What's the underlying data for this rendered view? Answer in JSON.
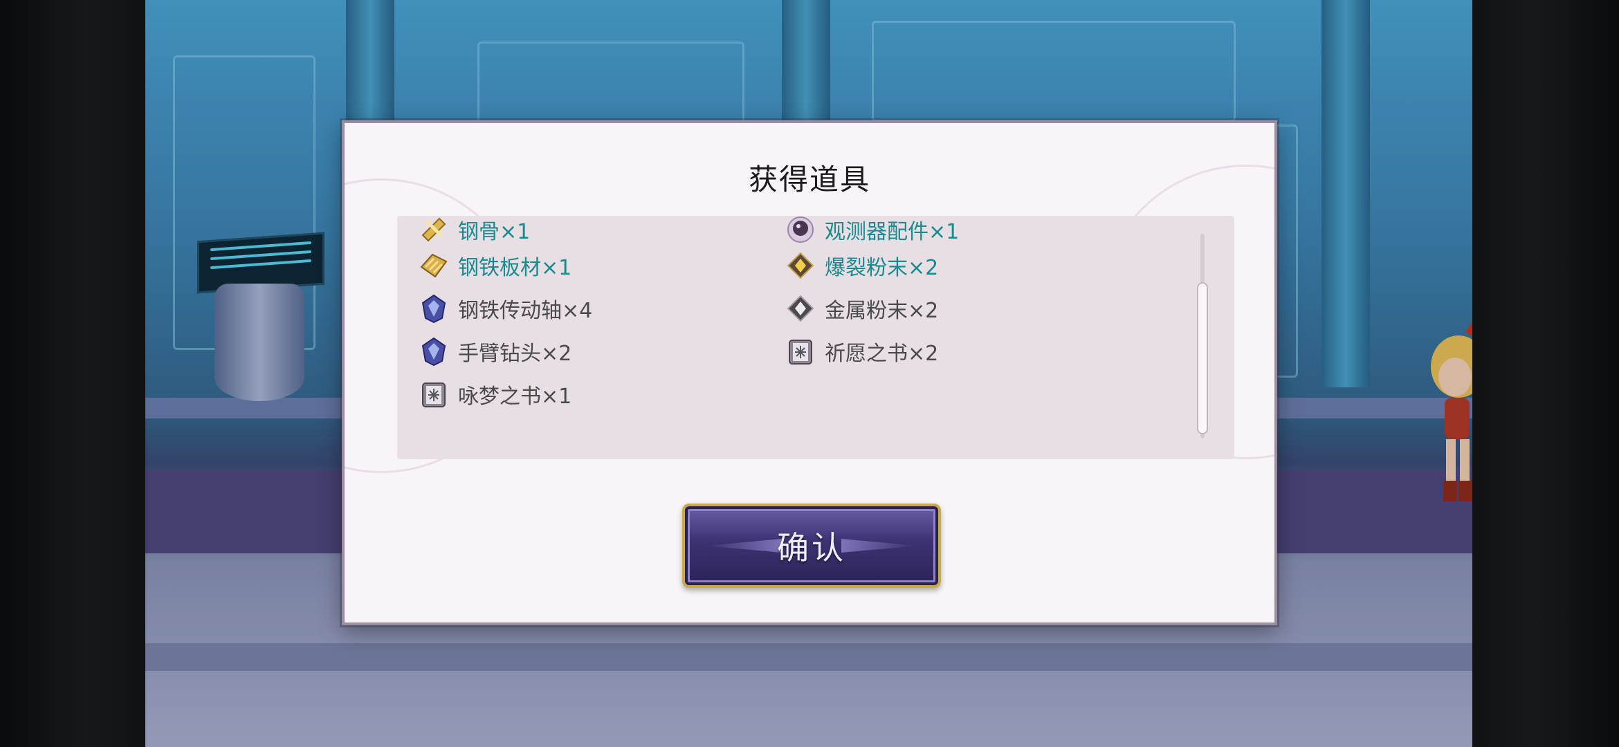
{
  "dialog": {
    "title": "获得道具",
    "confirm_label": "确认"
  },
  "items": [
    {
      "label": "钢骨×1",
      "icon": "steel-frame-icon",
      "rare": true
    },
    {
      "label": "观测器配件×1",
      "icon": "observer-part-icon",
      "rare": true
    },
    {
      "label": "钢铁板材×1",
      "icon": "steel-plate-icon",
      "rare": true
    },
    {
      "label": "爆裂粉末×2",
      "icon": "explosive-powder-icon",
      "rare": true
    },
    {
      "label": "钢铁传动轴×4",
      "icon": "steel-driveshaft-icon",
      "rare": false
    },
    {
      "label": "金属粉末×2",
      "icon": "metal-powder-icon",
      "rare": false
    },
    {
      "label": "手臂钻头×2",
      "icon": "arm-drill-icon",
      "rare": false
    },
    {
      "label": "祈愿之书×2",
      "icon": "book-of-prayer-icon",
      "rare": false
    },
    {
      "label": "咏梦之书×1",
      "icon": "book-of-dreams-icon",
      "rare": false
    }
  ],
  "colors": {
    "rare_text": "#1a8a8e",
    "common_text": "#4a4a4a",
    "button_border": "#caa949"
  }
}
